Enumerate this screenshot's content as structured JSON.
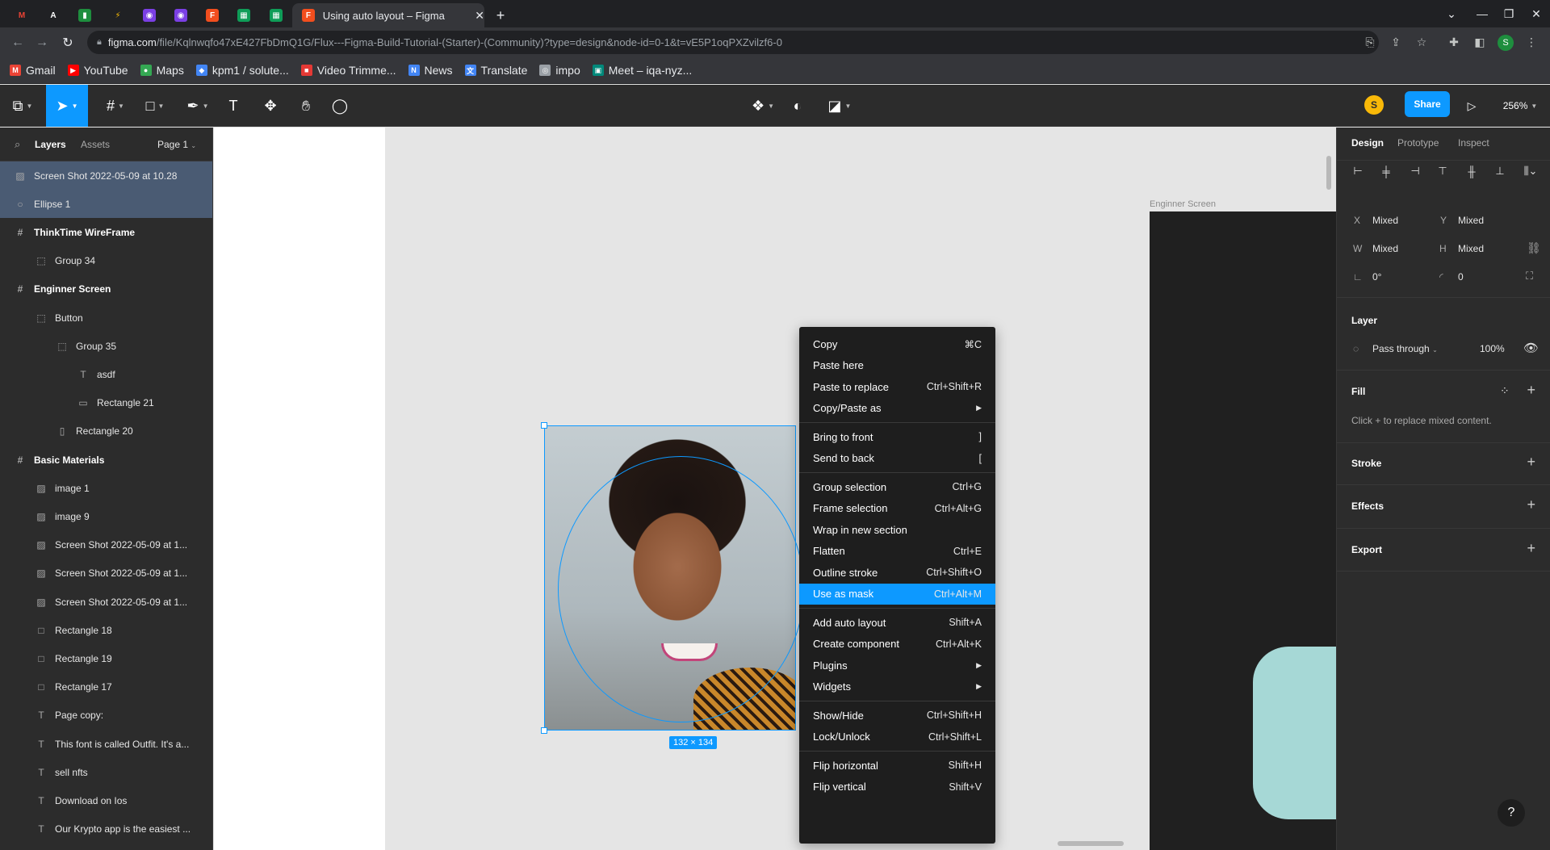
{
  "browser": {
    "active_tab_title": "Using auto layout – Figma",
    "tab_close": "✕",
    "new_tab": "+",
    "url_host": "figma.com",
    "url_path": "/file/Kqlnwqfo47xE427FbDmQ1G/Flux---Figma-Build-Tutorial-(Starter)-(Community)?type=design&node-id=0-1&t=vE5P1oqPXZvilzf6-0",
    "profile_initial": "S",
    "bookmarks": [
      {
        "label": "Gmail",
        "color": "#ea4335",
        "glyph": "M"
      },
      {
        "label": "YouTube",
        "color": "#ff0000",
        "glyph": "▶"
      },
      {
        "label": "Maps",
        "color": "#34a853",
        "glyph": "●"
      },
      {
        "label": "kpm1 / solute...",
        "color": "#4285f4",
        "glyph": "◆"
      },
      {
        "label": "Video Trimme...",
        "color": "#e53935",
        "glyph": "■"
      },
      {
        "label": "News",
        "color": "#4285f4",
        "glyph": "N"
      },
      {
        "label": "Translate",
        "color": "#4285f4",
        "glyph": "文"
      },
      {
        "label": "impo",
        "color": "#9aa0a6",
        "glyph": "◎"
      },
      {
        "label": "Meet – iqa-nyz...",
        "color": "#00897b",
        "glyph": "▣"
      }
    ]
  },
  "figma": {
    "share_label": "Share",
    "user_initial": "S",
    "zoom": "256%",
    "left_panel": {
      "tab_layers": "Layers",
      "tab_assets": "Assets",
      "page": "Page 1",
      "layers": [
        {
          "label": "Screen Shot 2022-05-09 at 10.28",
          "icon": "image-icon",
          "glyph": "▨",
          "indent": 0,
          "selected": true,
          "frame": false
        },
        {
          "label": "Ellipse 1",
          "icon": "ellipse-icon",
          "glyph": "○",
          "indent": 0,
          "selected": true,
          "frame": false
        },
        {
          "label": "ThinkTime WireFrame",
          "icon": "frame-icon",
          "glyph": "#",
          "indent": 0,
          "selected": false,
          "frame": true
        },
        {
          "label": "Group 34",
          "icon": "group-icon",
          "glyph": "⬚",
          "indent": 1,
          "selected": false,
          "frame": false
        },
        {
          "label": "Enginner Screen",
          "icon": "frame-icon",
          "glyph": "#",
          "indent": 0,
          "selected": false,
          "frame": true
        },
        {
          "label": "Button",
          "icon": "group-icon",
          "glyph": "⬚",
          "indent": 1,
          "selected": false,
          "frame": false
        },
        {
          "label": "Group 35",
          "icon": "group-icon",
          "glyph": "⬚",
          "indent": 2,
          "selected": false,
          "frame": false
        },
        {
          "label": "asdf",
          "icon": "text-icon",
          "glyph": "T",
          "indent": 3,
          "selected": false,
          "frame": false
        },
        {
          "label": "Rectangle 21",
          "icon": "rectangle-icon",
          "glyph": "▭",
          "indent": 3,
          "selected": false,
          "frame": false
        },
        {
          "label": "Rectangle 20",
          "icon": "rectangle-icon",
          "glyph": "▯",
          "indent": 2,
          "selected": false,
          "frame": false
        },
        {
          "label": "Basic Materials",
          "icon": "frame-icon",
          "glyph": "#",
          "indent": 0,
          "selected": false,
          "frame": true
        },
        {
          "label": "image 1",
          "icon": "image-icon",
          "glyph": "▨",
          "indent": 1,
          "selected": false,
          "frame": false
        },
        {
          "label": "image 9",
          "icon": "image-icon",
          "glyph": "▨",
          "indent": 1,
          "selected": false,
          "frame": false
        },
        {
          "label": "Screen Shot 2022-05-09 at 1...",
          "icon": "image-icon",
          "glyph": "▨",
          "indent": 1,
          "selected": false,
          "frame": false
        },
        {
          "label": "Screen Shot 2022-05-09 at 1...",
          "icon": "image-icon",
          "glyph": "▨",
          "indent": 1,
          "selected": false,
          "frame": false
        },
        {
          "label": "Screen Shot 2022-05-09 at 1...",
          "icon": "image-icon",
          "glyph": "▨",
          "indent": 1,
          "selected": false,
          "frame": false
        },
        {
          "label": "Rectangle 18",
          "icon": "rectangle-icon",
          "glyph": "□",
          "indent": 1,
          "selected": false,
          "frame": false
        },
        {
          "label": "Rectangle 19",
          "icon": "rectangle-icon",
          "glyph": "□",
          "indent": 1,
          "selected": false,
          "frame": false
        },
        {
          "label": "Rectangle 17",
          "icon": "rectangle-icon",
          "glyph": "□",
          "indent": 1,
          "selected": false,
          "frame": false
        },
        {
          "label": "Page copy:",
          "icon": "text-icon",
          "glyph": "T",
          "indent": 1,
          "selected": false,
          "frame": false
        },
        {
          "label": "This font is called Outfit. It's a...",
          "icon": "text-icon",
          "glyph": "T",
          "indent": 1,
          "selected": false,
          "frame": false
        },
        {
          "label": "sell nfts",
          "icon": "text-icon",
          "glyph": "T",
          "indent": 1,
          "selected": false,
          "frame": false
        },
        {
          "label": "Download on Ios",
          "icon": "text-icon",
          "glyph": "T",
          "indent": 1,
          "selected": false,
          "frame": false
        },
        {
          "label": "Our Krypto app is the easiest ...",
          "icon": "text-icon",
          "glyph": "T",
          "indent": 1,
          "selected": false,
          "frame": false
        }
      ]
    },
    "canvas": {
      "frame_label": "Enginner Screen",
      "dimension_badge": "132 × 134"
    },
    "context_menu": [
      {
        "label": "Copy",
        "shortcut": "⌘C",
        "arrow": false,
        "highlight": false,
        "sep_before": false
      },
      {
        "label": "Paste here",
        "shortcut": "",
        "arrow": false,
        "highlight": false,
        "sep_before": false
      },
      {
        "label": "Paste to replace",
        "shortcut": "Ctrl+Shift+R",
        "arrow": false,
        "highlight": false,
        "sep_before": false
      },
      {
        "label": "Copy/Paste as",
        "shortcut": "",
        "arrow": true,
        "highlight": false,
        "sep_before": false
      },
      {
        "label": "Bring to front",
        "shortcut": "]",
        "arrow": false,
        "highlight": false,
        "sep_before": true
      },
      {
        "label": "Send to back",
        "shortcut": "[",
        "arrow": false,
        "highlight": false,
        "sep_before": false
      },
      {
        "label": "Group selection",
        "shortcut": "Ctrl+G",
        "arrow": false,
        "highlight": false,
        "sep_before": true
      },
      {
        "label": "Frame selection",
        "shortcut": "Ctrl+Alt+G",
        "arrow": false,
        "highlight": false,
        "sep_before": false
      },
      {
        "label": "Wrap in new section",
        "shortcut": "",
        "arrow": false,
        "highlight": false,
        "sep_before": false
      },
      {
        "label": "Flatten",
        "shortcut": "Ctrl+E",
        "arrow": false,
        "highlight": false,
        "sep_before": false
      },
      {
        "label": "Outline stroke",
        "shortcut": "Ctrl+Shift+O",
        "arrow": false,
        "highlight": false,
        "sep_before": false
      },
      {
        "label": "Use as mask",
        "shortcut": "Ctrl+Alt+M",
        "arrow": false,
        "highlight": true,
        "sep_before": false
      },
      {
        "label": "Add auto layout",
        "shortcut": "Shift+A",
        "arrow": false,
        "highlight": false,
        "sep_before": true
      },
      {
        "label": "Create component",
        "shortcut": "Ctrl+Alt+K",
        "arrow": false,
        "highlight": false,
        "sep_before": false
      },
      {
        "label": "Plugins",
        "shortcut": "",
        "arrow": true,
        "highlight": false,
        "sep_before": false
      },
      {
        "label": "Widgets",
        "shortcut": "",
        "arrow": true,
        "highlight": false,
        "sep_before": false
      },
      {
        "label": "Show/Hide",
        "shortcut": "Ctrl+Shift+H",
        "arrow": false,
        "highlight": false,
        "sep_before": true
      },
      {
        "label": "Lock/Unlock",
        "shortcut": "Ctrl+Shift+L",
        "arrow": false,
        "highlight": false,
        "sep_before": false
      },
      {
        "label": "Flip horizontal",
        "shortcut": "Shift+H",
        "arrow": false,
        "highlight": false,
        "sep_before": true
      },
      {
        "label": "Flip vertical",
        "shortcut": "Shift+V",
        "arrow": false,
        "highlight": false,
        "sep_before": false
      }
    ],
    "right_panel": {
      "tab_design": "Design",
      "tab_prototype": "Prototype",
      "tab_inspect": "Inspect",
      "x_label": "X",
      "x_value": "Mixed",
      "y_label": "Y",
      "y_value": "Mixed",
      "w_label": "W",
      "w_value": "Mixed",
      "h_label": "H",
      "h_value": "Mixed",
      "rotation": "0°",
      "radius": "0",
      "layer_title": "Layer",
      "blend_mode": "Pass through",
      "opacity": "100%",
      "fill_title": "Fill",
      "fill_hint": "Click + to replace mixed content.",
      "stroke_title": "Stroke",
      "effects_title": "Effects",
      "export_title": "Export",
      "help": "?"
    }
  }
}
